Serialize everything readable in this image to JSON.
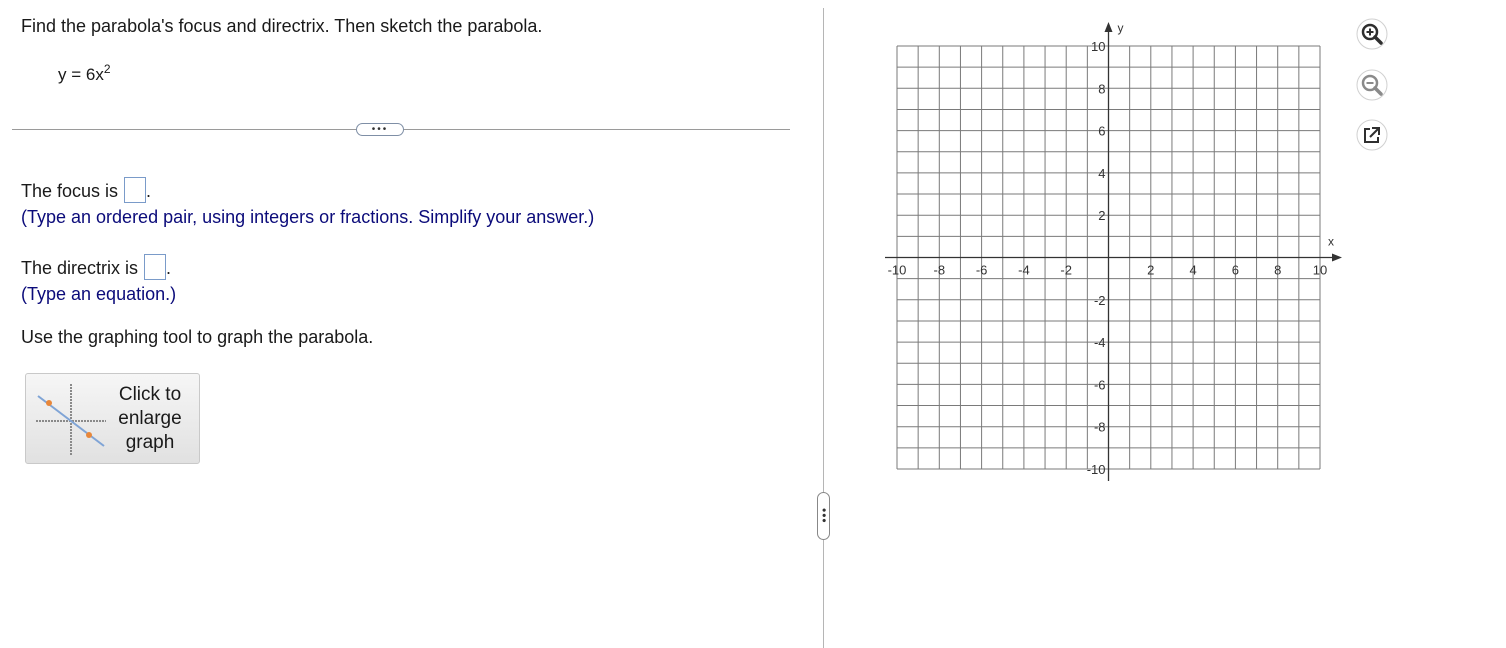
{
  "question": {
    "prompt": "Find the parabola's focus and directrix. Then sketch the parabola.",
    "equation_lhs": "y = 6x",
    "equation_exponent": "2"
  },
  "more_button_label": "•••",
  "focus": {
    "label": "The focus is",
    "value": "",
    "end_punct": ".",
    "hint": "(Type an ordered pair, using integers or fractions. Simplify your answer.)"
  },
  "directrix": {
    "label": "The directrix is",
    "value": "",
    "end_punct": ".",
    "hint": "(Type an equation.)"
  },
  "graph_instruction": "Use the graphing tool to graph the parabola.",
  "enlarge_button": {
    "line1": "Click to",
    "line2": "enlarge",
    "line3": "graph"
  },
  "pane_handle_label": "•••",
  "graph": {
    "x_axis_label": "x",
    "y_axis_label": "y",
    "x_range": [
      -10,
      10
    ],
    "y_range": [
      -10,
      10
    ],
    "grid_step": 1,
    "x_tick_labels": [
      "-10",
      "-8",
      "-6",
      "-4",
      "-2",
      "2",
      "4",
      "6",
      "8",
      "10"
    ],
    "y_tick_labels": [
      "10",
      "8",
      "6",
      "4",
      "2",
      "-2",
      "-4",
      "-6",
      "-8",
      "-10"
    ]
  },
  "tools": [
    {
      "name": "zoom-in-icon"
    },
    {
      "name": "zoom-out-icon"
    },
    {
      "name": "popout-icon"
    }
  ],
  "colors": {
    "hint_text": "#0b0b7a",
    "grid_line": "#7a7a7a",
    "axis": "#333333",
    "answer_box_border": "#7a9bc9",
    "tool_icon": "#2f2f2f"
  }
}
